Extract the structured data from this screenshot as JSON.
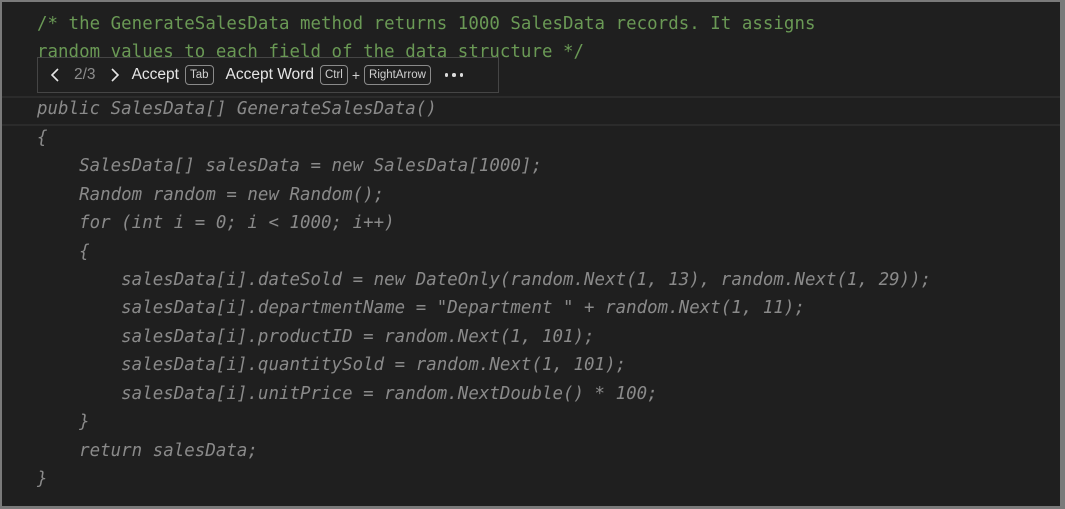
{
  "editor": {
    "comment_lines": [
      "/* the GenerateSalesData method returns 1000 SalesData records. It assigns",
      "random values to each field of the data structure */"
    ],
    "suggestion_lines": [
      "public SalesData[] GenerateSalesData()",
      "{",
      "    SalesData[] salesData = new SalesData[1000];",
      "    Random random = new Random();",
      "    for (int i = 0; i < 1000; i++)",
      "    {",
      "        salesData[i].dateSold = new DateOnly(random.Next(1, 13), random.Next(1, 29));",
      "        salesData[i].departmentName = \"Department \" + random.Next(1, 11);",
      "        salesData[i].productID = random.Next(1, 101);",
      "        salesData[i].quantitySold = random.Next(1, 101);",
      "        salesData[i].unitPrice = random.NextDouble() * 100;",
      "    }",
      "    return salesData;",
      "}"
    ]
  },
  "suggestion_toolbar": {
    "prev_icon": "chevron-left-icon",
    "next_icon": "chevron-right-icon",
    "counter": "2/3",
    "accept_label": "Accept",
    "accept_key": "Tab",
    "accept_word_label": "Accept Word",
    "accept_word_key1": "Ctrl",
    "plus": "+",
    "accept_word_key2": "RightArrow",
    "more_icon": "more-horizontal-icon"
  },
  "colors": {
    "background": "#1f1f1f",
    "comment": "#6a9955",
    "ghost_text": "#8a8a8a"
  }
}
